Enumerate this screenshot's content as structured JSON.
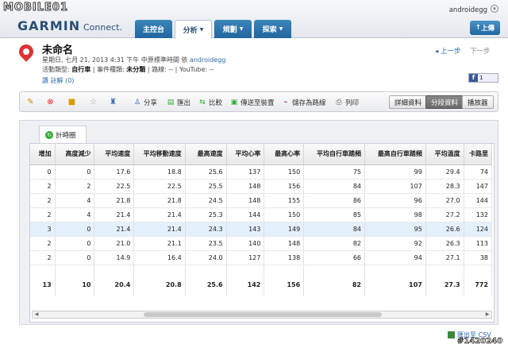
{
  "watermark_top": "MOBILE01",
  "brand": {
    "name": "GARMIN",
    "sub": "Connect."
  },
  "user": {
    "name": "androidegg"
  },
  "nav": [
    {
      "label": "主控台",
      "caret": ""
    },
    {
      "label": "分析",
      "caret": "▼"
    },
    {
      "label": "規劃",
      "caret": "▼"
    },
    {
      "label": "探索",
      "caret": "▼"
    }
  ],
  "upload_label": "上傳",
  "activity": {
    "title": "未命名",
    "date_line": "星期日, 七月 21, 2013 4:31 下午 中原標準時間 依",
    "user": "androidegg",
    "type_prefix": "活動類型:",
    "type": "自行車",
    "event_prefix": "| 事件種類:",
    "event": "未分類",
    "route_prefix": "| 路線:",
    "route": "--",
    "youtube": "| YouTube: --",
    "like_label": "讚",
    "comments_label": "註解 (0)"
  },
  "pager": {
    "prev": "上一步",
    "next": "下一步"
  },
  "share": {
    "count": "1"
  },
  "toolbar": {
    "share": "分享",
    "export": "匯出",
    "compare": "比較",
    "send": "傳送至裝置",
    "save_route": "儲存為路線",
    "print": "列印",
    "view_detail": "詳細資料",
    "view_split": "分段資料",
    "view_player": "播放器"
  },
  "panel_tab": "計時圈",
  "table": {
    "headers": [
      "增加",
      "高度減少",
      "平均速度",
      "平均移動速度",
      "最高速度",
      "平均心率",
      "最高心率",
      "平均自行車踏頻",
      "最高自行車踏頻",
      "平均溫度",
      "卡路里"
    ],
    "rows": [
      [
        "0",
        "0",
        "17.6",
        "18.8",
        "25.6",
        "137",
        "150",
        "75",
        "99",
        "29.4",
        "74"
      ],
      [
        "2",
        "2",
        "22.5",
        "22.5",
        "25.5",
        "148",
        "156",
        "84",
        "107",
        "28.3",
        "147"
      ],
      [
        "2",
        "4",
        "21.8",
        "21.8",
        "24.5",
        "148",
        "155",
        "86",
        "96",
        "27.0",
        "144"
      ],
      [
        "2",
        "4",
        "21.4",
        "21.4",
        "25.3",
        "144",
        "150",
        "85",
        "98",
        "27.2",
        "132"
      ],
      [
        "3",
        "0",
        "21.4",
        "21.4",
        "24.3",
        "143",
        "149",
        "84",
        "95",
        "26.6",
        "124"
      ],
      [
        "2",
        "0",
        "21.0",
        "21.1",
        "23.5",
        "140",
        "148",
        "82",
        "92",
        "26.3",
        "113"
      ],
      [
        "2",
        "0",
        "14.9",
        "16.4",
        "24.0",
        "127",
        "138",
        "66",
        "94",
        "27.1",
        "38"
      ]
    ],
    "totals": [
      "13",
      "10",
      "20.4",
      "20.8",
      "25.6",
      "142",
      "156",
      "82",
      "107",
      "27.3",
      "772"
    ]
  },
  "csv_label": "匯出至 CSV",
  "watermark_bottom": "#1420240"
}
